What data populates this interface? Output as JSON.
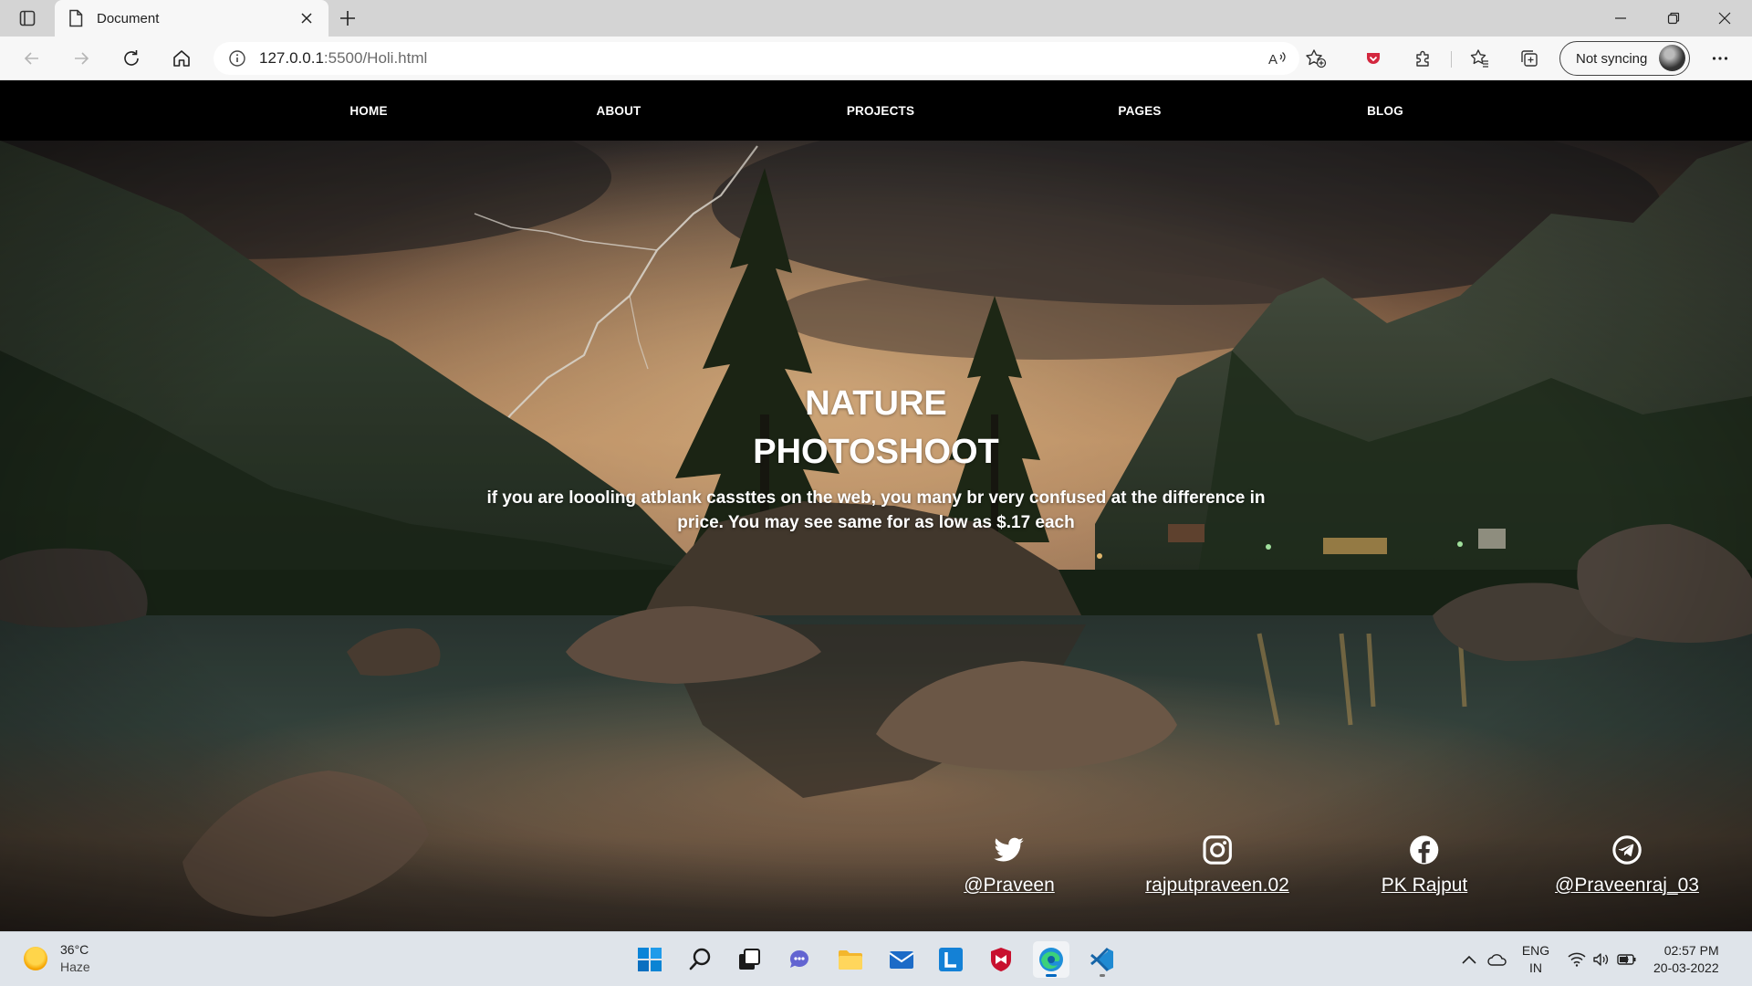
{
  "browser": {
    "tab_title": "Document",
    "url_host": "127.0.0.1",
    "url_rest": ":5500/Holi.html",
    "sync_label": "Not syncing"
  },
  "site": {
    "nav": [
      {
        "label": "HOME"
      },
      {
        "label": "ABOUT"
      },
      {
        "label": "PROJECTS"
      },
      {
        "label": "PAGES"
      },
      {
        "label": "BLOG"
      }
    ],
    "hero": {
      "title_line1": "NATURE",
      "title_line2": "PHOTOSHOOT",
      "text_line1": "if you are loooling atblank cassttes on the web, you many br very confused at the difference in",
      "text_line2": "price. You may see same for as low as $.17 each"
    },
    "social": [
      {
        "icon": "twitter-icon",
        "handle": "@Praveen"
      },
      {
        "icon": "instagram-icon",
        "handle": "rajputpraveen.02"
      },
      {
        "icon": "facebook-icon",
        "handle": "PK Rajput"
      },
      {
        "icon": "telegram-icon",
        "handle": "@Praveenraj_03"
      }
    ]
  },
  "taskbar": {
    "weather_temp": "36°C",
    "weather_desc": "Haze",
    "lang_line1": "ENG",
    "lang_line2": "IN",
    "time": "02:57 PM",
    "date": "20-03-2022"
  },
  "colors": {
    "nav_bg": "#000000",
    "taskbar_bg": "#dfe4ea",
    "browser_chrome": "#f7f7f7",
    "accent": "#0067c0"
  }
}
